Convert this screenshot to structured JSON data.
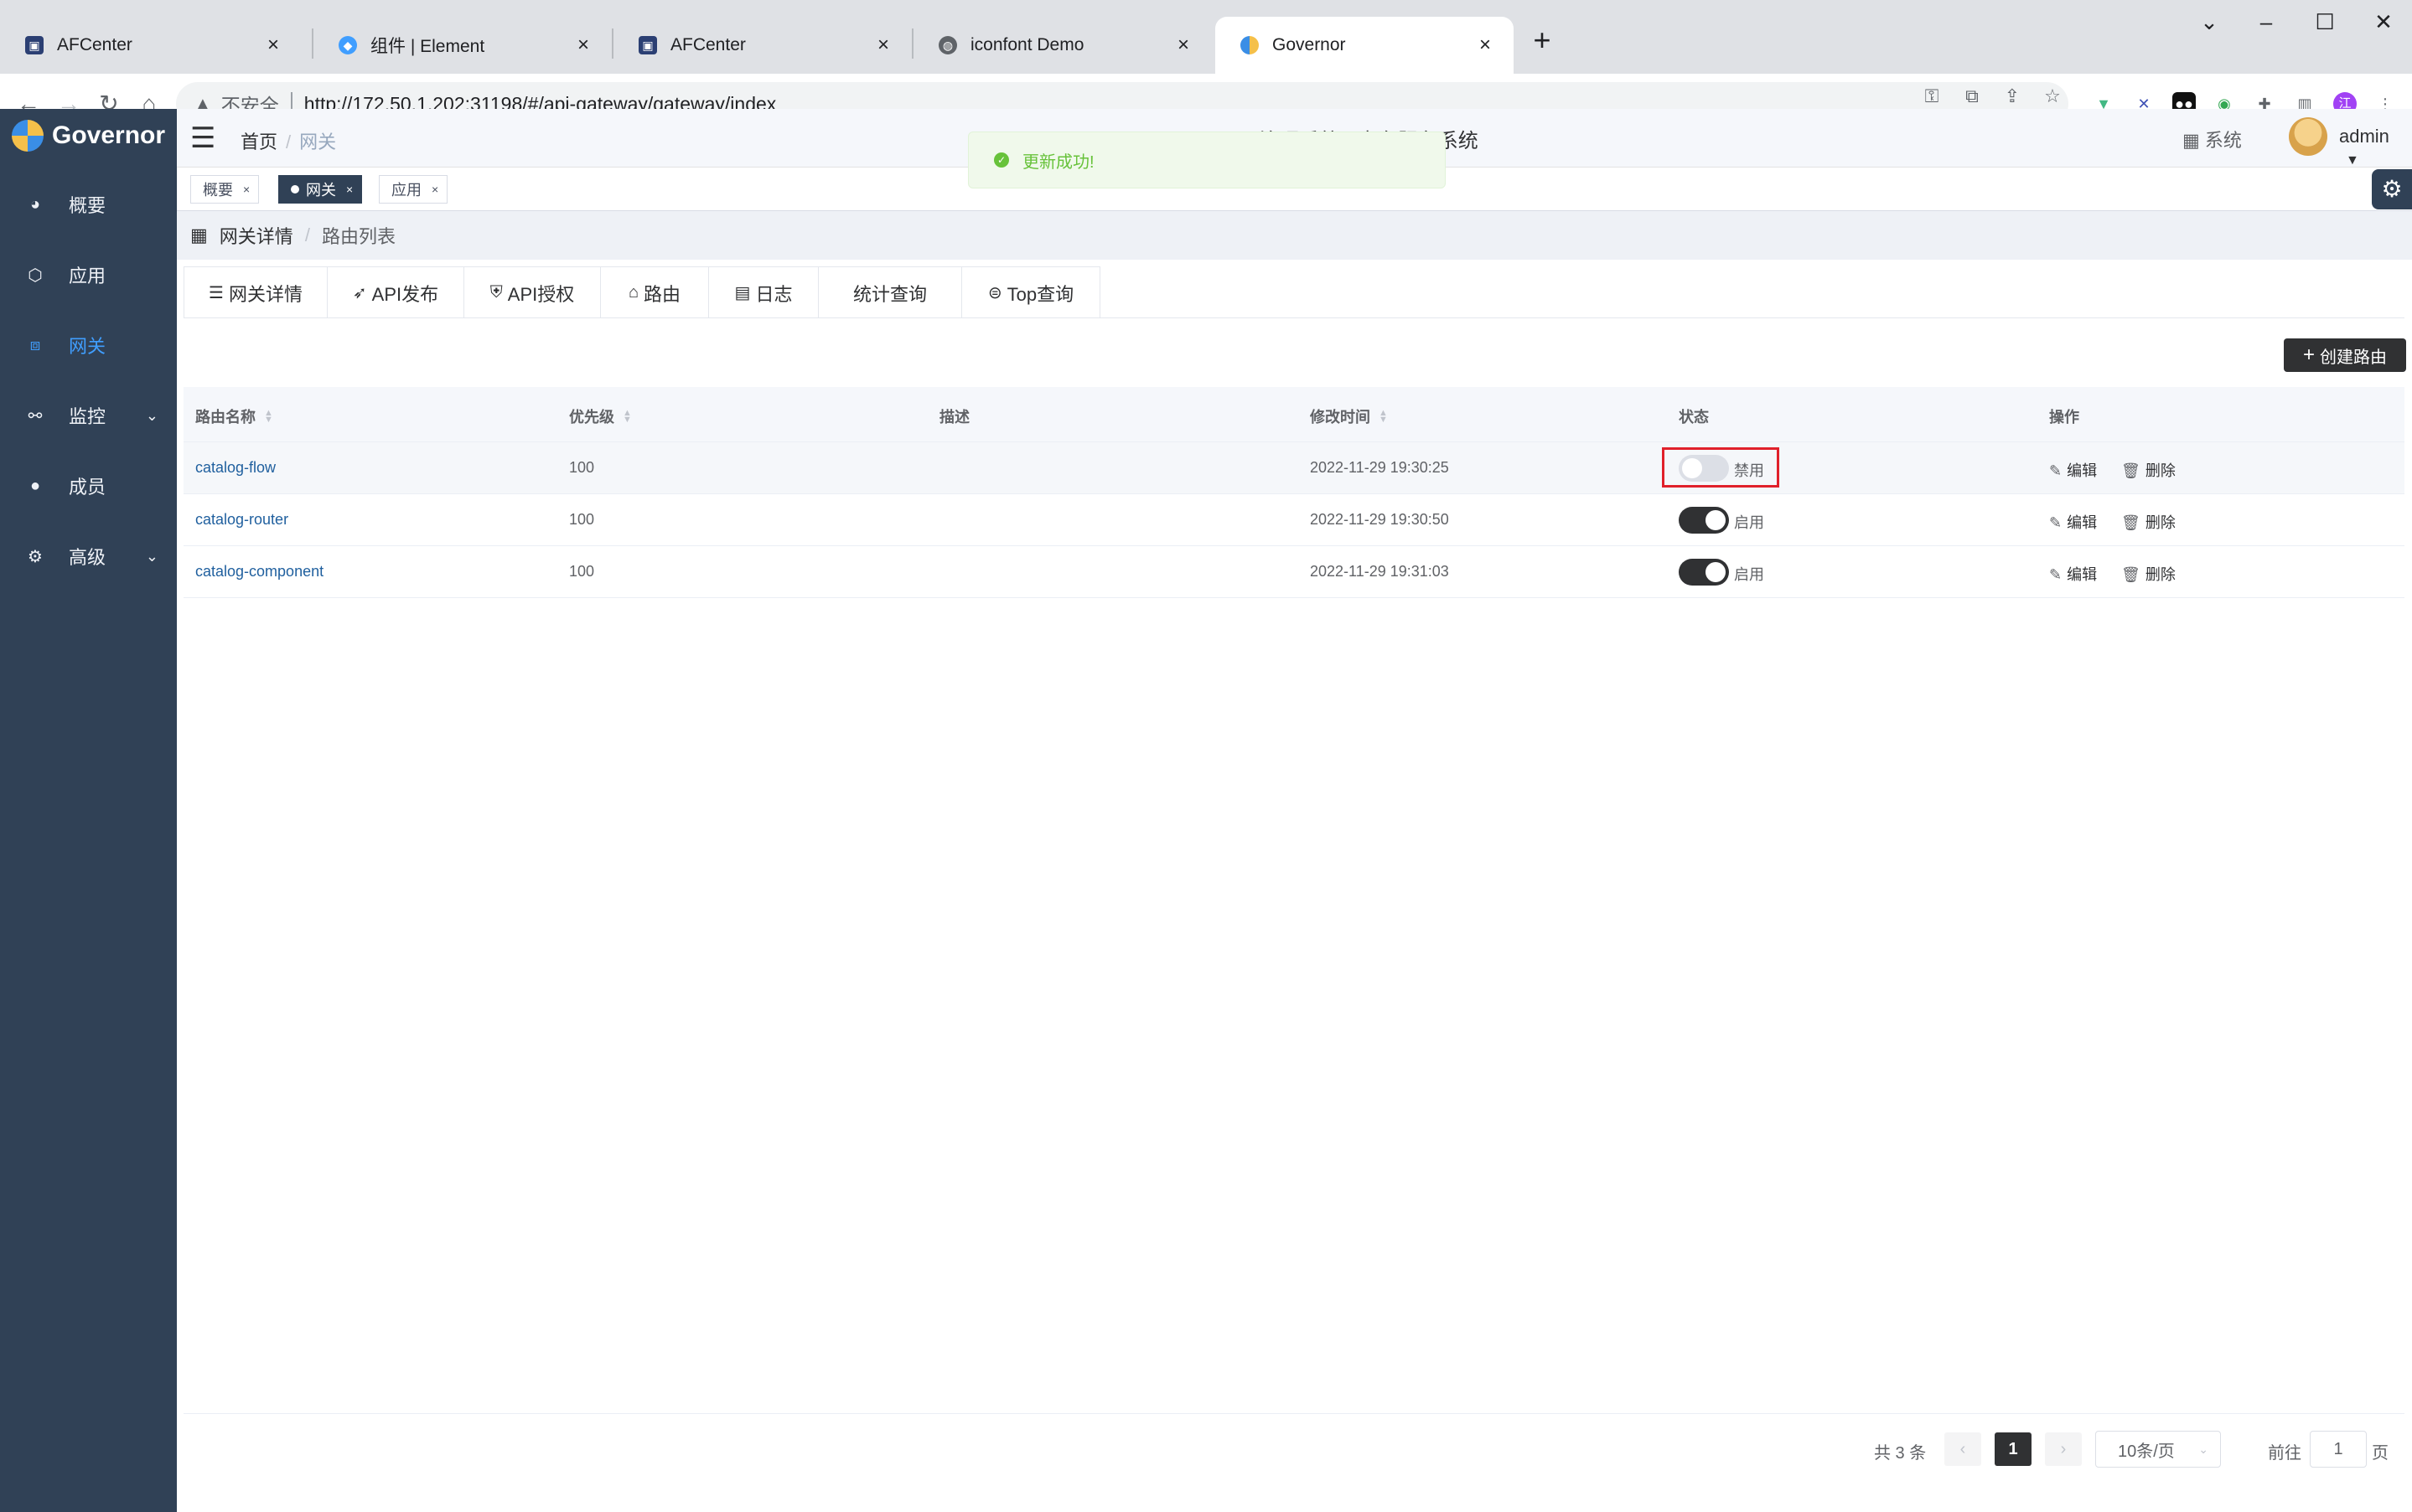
{
  "browser": {
    "tabs": [
      {
        "title": "AFCenter",
        "favicon": "afcenter-icon",
        "active": false
      },
      {
        "title": "组件 | Element",
        "favicon": "element-icon",
        "active": false
      },
      {
        "title": "AFCenter",
        "favicon": "afcenter-icon",
        "active": false
      },
      {
        "title": "iconfont Demo",
        "favicon": "globe-icon",
        "active": false
      },
      {
        "title": "Governor",
        "favicon": "governor-icon",
        "active": true
      }
    ],
    "close_glyph": "×",
    "new_tab_glyph": "+",
    "address": {
      "security_label": "不安全",
      "url": "http://172.50.1.202:31198/#/api-gateway/gateway/index"
    },
    "profile_initial": "江"
  },
  "app": {
    "brand": "Governor",
    "sidebar": [
      {
        "label": "概要",
        "icon": "dashboard-icon",
        "active": false,
        "has_children": false
      },
      {
        "label": "应用",
        "icon": "cube-icon",
        "active": false,
        "has_children": false
      },
      {
        "label": "网关",
        "icon": "gateway-icon",
        "active": true,
        "has_children": false
      },
      {
        "label": "监控",
        "icon": "monitor-icon",
        "active": false,
        "has_children": true
      },
      {
        "label": "成员",
        "icon": "user-icon",
        "active": false,
        "has_children": false
      },
      {
        "label": "高级",
        "icon": "gears-icon",
        "active": false,
        "has_children": true
      }
    ],
    "header": {
      "breadcrumb_home": "首页",
      "breadcrumb_current": "网关",
      "center_text": "Governor · 治理系统 · 中台服务系统",
      "system_label": "系统",
      "user_name": "admin"
    },
    "tags": [
      {
        "label": "概要",
        "active": false
      },
      {
        "label": "网关",
        "active": true
      },
      {
        "label": "应用",
        "active": false
      }
    ],
    "page_breadcrumb": [
      "网关详情",
      "路由列表"
    ],
    "gateway_tabs": [
      {
        "label": "网关详情",
        "icon": "list-icon"
      },
      {
        "label": "API发布",
        "icon": "rocket-icon"
      },
      {
        "label": "API授权",
        "icon": "shield-icon"
      },
      {
        "label": "路由",
        "icon": "router-icon"
      },
      {
        "label": "日志",
        "icon": "log-icon"
      },
      {
        "label": "统计查询",
        "icon": ""
      },
      {
        "label": "Top查询",
        "icon": "top-icon"
      }
    ],
    "create_button": "创建路由",
    "table": {
      "columns": [
        "路由名称",
        "优先级",
        "描述",
        "修改时间",
        "状态",
        "操作"
      ],
      "rows": [
        {
          "name": "catalog-flow",
          "priority": "100",
          "desc": "",
          "modified": "2022-11-29 19:30:25",
          "enabled": false,
          "status_label": "禁用"
        },
        {
          "name": "catalog-router",
          "priority": "100",
          "desc": "",
          "modified": "2022-11-29 19:30:50",
          "enabled": true,
          "status_label": "启用"
        },
        {
          "name": "catalog-component",
          "priority": "100",
          "desc": "",
          "modified": "2022-11-29 19:31:03",
          "enabled": true,
          "status_label": "启用"
        }
      ],
      "actions": {
        "edit": "编辑",
        "delete": "删除"
      }
    },
    "toast": {
      "message": "更新成功!",
      "type": "success",
      "color": "#67c23a"
    },
    "pagination": {
      "total_text": "共 3 条",
      "current_page": "1",
      "page_size": "10条/页",
      "goto_prefix": "前往",
      "goto_value": "1",
      "goto_suffix": "页"
    },
    "colors": {
      "sidebar_bg": "#304156",
      "active_menu": "#409eff",
      "primary_dark": "#303133",
      "link": "#1f5f9e",
      "highlight_box": "#e0202a"
    }
  }
}
